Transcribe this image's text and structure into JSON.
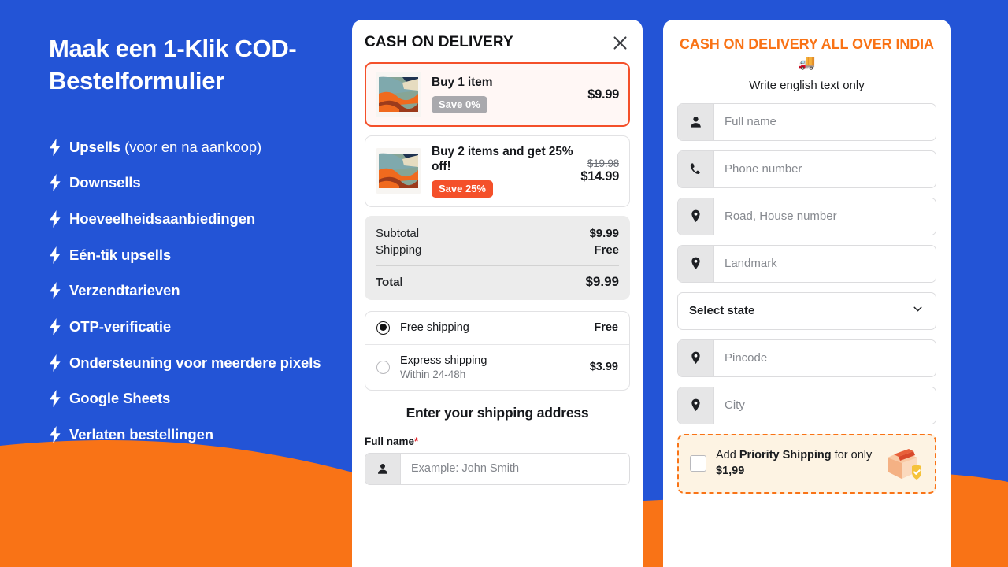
{
  "theme": {
    "blue": "#2354d6",
    "orange": "#f97316",
    "accent_red": "#f4502a",
    "card_white": "#ffffff",
    "cream": "#fdf3e3"
  },
  "promo": {
    "title": "Maak een 1-Klik COD-Bestelformulier",
    "items": [
      {
        "bold": "Upsells",
        "regular": " (voor en na aankoop)"
      },
      {
        "bold": "Downsells",
        "regular": ""
      },
      {
        "bold": "Hoeveelheidsaanbiedingen",
        "regular": ""
      },
      {
        "bold": "Eén-tik upsells",
        "regular": ""
      },
      {
        "bold": "Verzendtarieven",
        "regular": ""
      },
      {
        "bold": "OTP-verificatie",
        "regular": ""
      },
      {
        "bold": "Ondersteuning voor meerdere pixels",
        "regular": ""
      },
      {
        "bold": "Google Sheets",
        "regular": ""
      },
      {
        "bold": "Verlaten bestellingen",
        "regular": ""
      }
    ]
  },
  "middle": {
    "title": "CASH ON DELIVERY",
    "close_icon": "close-icon",
    "offers": [
      {
        "name": "Buy 1 item",
        "badge": "Save 0%",
        "badge_style": "grey",
        "price_old": "",
        "price_now": "$9.99",
        "selected": true
      },
      {
        "name": "Buy 2 items and get 25% off!",
        "badge": "Save 25%",
        "badge_style": "orange",
        "price_old": "$19.98",
        "price_now": "$14.99",
        "selected": false
      }
    ],
    "summary": {
      "subtotal_label": "Subtotal",
      "subtotal_value": "$9.99",
      "shipping_label": "Shipping",
      "shipping_value": "Free",
      "total_label": "Total",
      "total_value": "$9.99"
    },
    "shipping_methods": [
      {
        "name": "Free shipping",
        "sub": "",
        "price": "Free",
        "selected": true
      },
      {
        "name": "Express shipping",
        "sub": "Within 24-48h",
        "price": "$3.99",
        "selected": false
      }
    ],
    "address_heading": "Enter your shipping address",
    "fullname_label": "Full name",
    "fullname_required": "*",
    "fullname_placeholder": "Example: John Smith",
    "fullname_icon": "person-icon"
  },
  "right": {
    "title": "CASH ON DELIVERY ALL OVER INDIA 🚚",
    "subtitle": "Write english text only",
    "fields": [
      {
        "placeholder": "Full name",
        "icon": "person-icon"
      },
      {
        "placeholder": "Phone number",
        "icon": "phone-icon"
      },
      {
        "placeholder": "Road, House number",
        "icon": "location-pin-icon"
      },
      {
        "placeholder": "Landmark",
        "icon": "location-pin-icon"
      }
    ],
    "state_select": {
      "value": "Select state",
      "icon": "chevron-down-icon"
    },
    "fields_after": [
      {
        "placeholder": "Pincode",
        "icon": "location-pin-icon"
      },
      {
        "placeholder": "City",
        "icon": "location-pin-icon"
      }
    ],
    "priority": {
      "prefix": "Add ",
      "bold": "Priority Shipping",
      "middle": " for only ",
      "price": "$1,99",
      "icon": "package-shield-icon"
    }
  }
}
